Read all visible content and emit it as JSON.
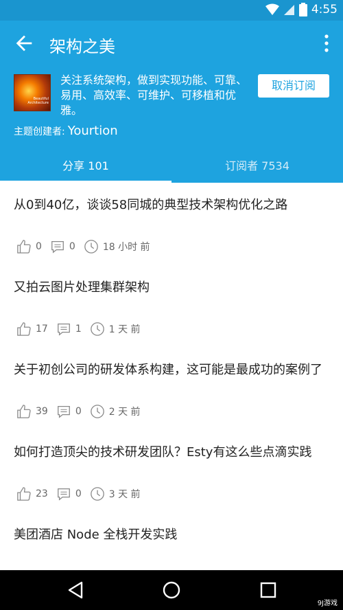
{
  "status_bar": {
    "time": "4:55"
  },
  "app_bar": {
    "title": "架构之美"
  },
  "header": {
    "cover_text": "Beautiful Architecture",
    "description": "关注系统架构，做到实现功能、可靠、易用、高效率、可维护、可移植和优雅。",
    "unsubscribe_label": "取消订阅",
    "creator_label": "主题创建者:",
    "creator_name": "Yourtion"
  },
  "tabs": [
    {
      "label": "分享 101",
      "active": true
    },
    {
      "label": "订阅者 7534",
      "active": false
    }
  ],
  "posts": [
    {
      "title": "从0到40亿，谈谈58同城的典型技术架构优化之路",
      "likes": "0",
      "comments": "0",
      "time": "18 小时 前"
    },
    {
      "title": "又拍云图片处理集群架构",
      "likes": "17",
      "comments": "1",
      "time": "1 天 前"
    },
    {
      "title": "关于初创公司的研发体系构建，这可能是最成功的案例了",
      "likes": "39",
      "comments": "0",
      "time": "2 天 前"
    },
    {
      "title": "如何打造顶尖的技术研发团队？Esty有这么些点滴实践",
      "likes": "23",
      "comments": "0",
      "time": "3 天 前"
    },
    {
      "title": "美团酒店 Node 全栈开发实践"
    }
  ],
  "watermark": "9J游戏",
  "colors": {
    "primary": "#1ea3df",
    "status_bar": "#1a95cf"
  }
}
